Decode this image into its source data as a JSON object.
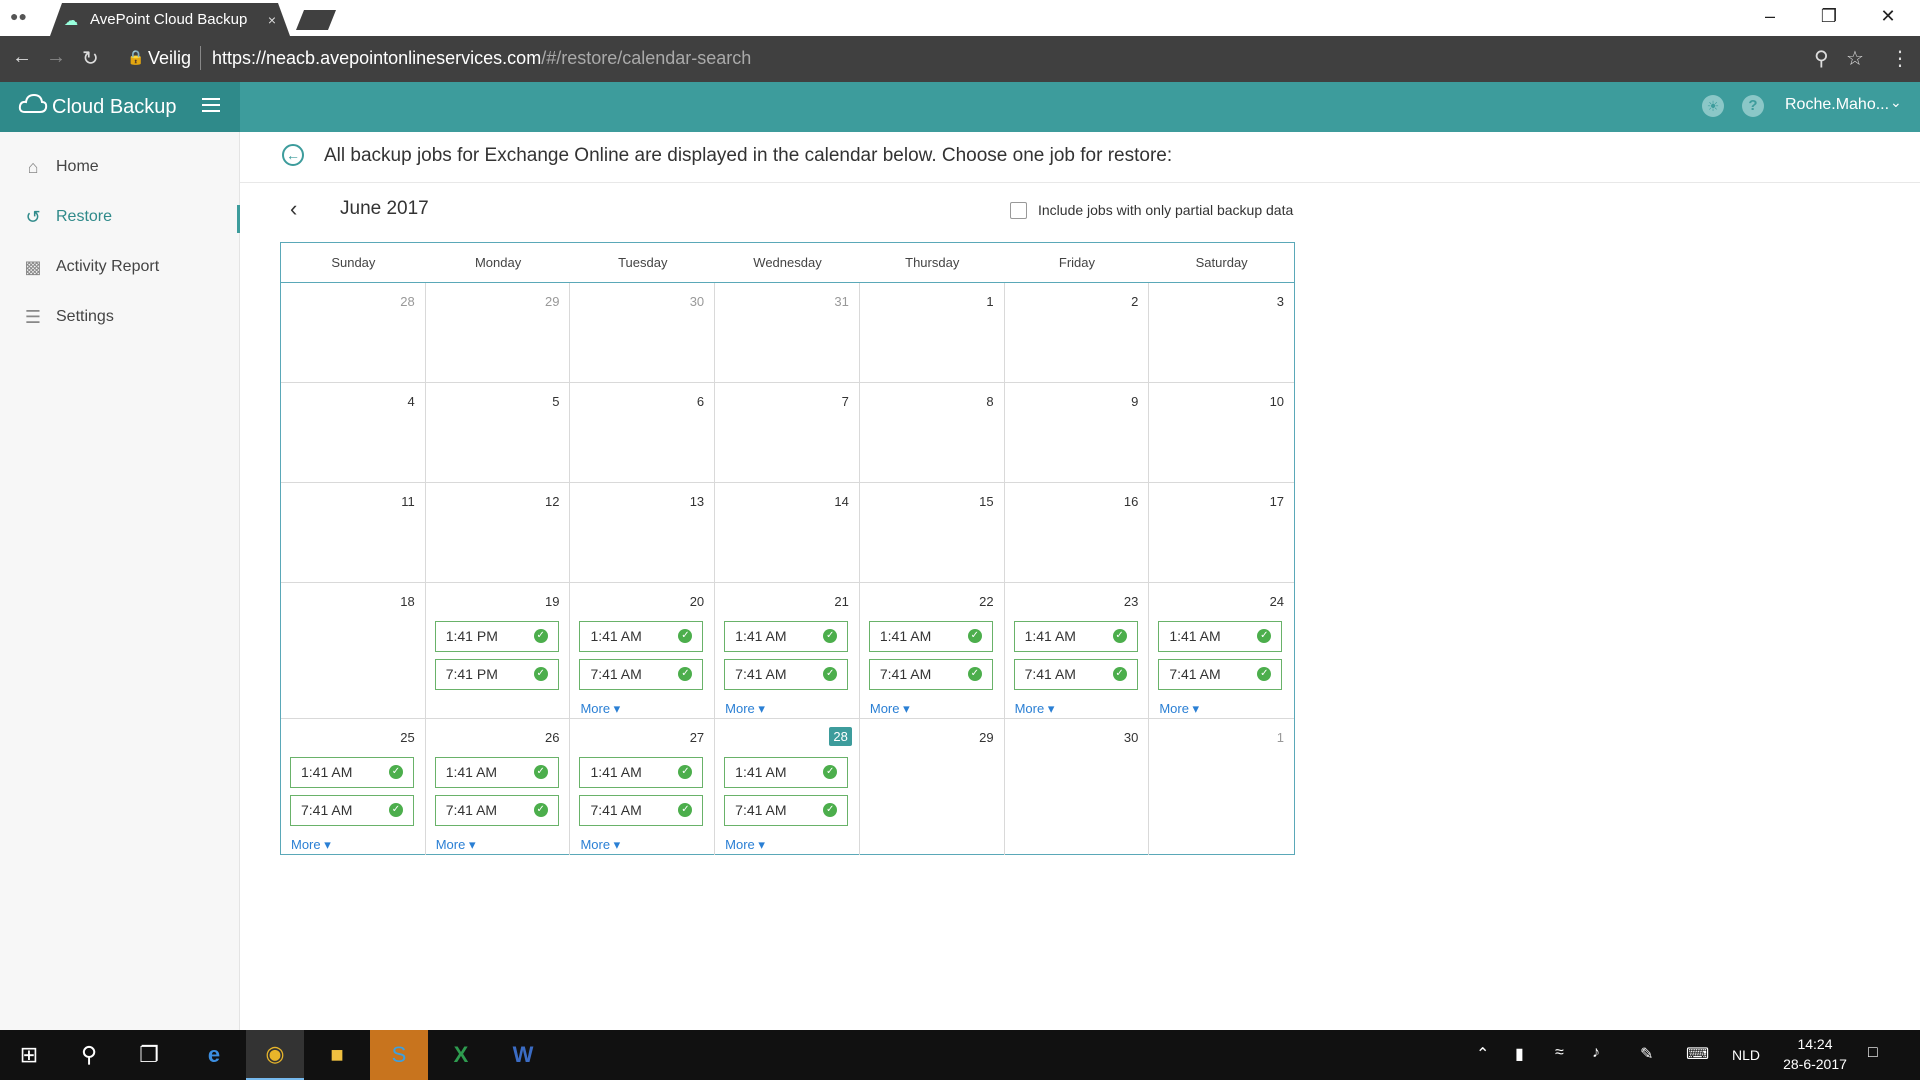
{
  "browser": {
    "tab_title": "AvePoint Cloud Backup",
    "tab_close": "×",
    "secure_label": "Veilig",
    "url_main": "https://neacb.avepointonlineservices.com",
    "url_rest": "/#/restore/calendar-search"
  },
  "app": {
    "brand_name": "Cloud Backup",
    "user_name": "Roche.Maho...",
    "accent_color": "#3d9c9c"
  },
  "sidebar": {
    "items": [
      {
        "label": "Home",
        "icon": "home-icon"
      },
      {
        "label": "Restore",
        "icon": "restore-icon",
        "active": true
      },
      {
        "label": "Activity Report",
        "icon": "chart-icon"
      },
      {
        "label": "Settings",
        "icon": "sliders-icon"
      }
    ]
  },
  "main": {
    "description": "All backup jobs for Exchange Online are displayed in the calendar below. Choose one job for restore:",
    "month": "June 2017",
    "partial_label": "Include jobs with only partial backup data"
  },
  "calendar": {
    "weekdays": [
      "Sunday",
      "Monday",
      "Tuesday",
      "Wednesday",
      "Thursday",
      "Friday",
      "Saturday"
    ],
    "more_label": "More",
    "weeks": [
      [
        {
          "d": "28",
          "other": true
        },
        {
          "d": "29",
          "other": true
        },
        {
          "d": "30",
          "other": true
        },
        {
          "d": "31",
          "other": true
        },
        {
          "d": "1"
        },
        {
          "d": "2"
        },
        {
          "d": "3"
        }
      ],
      [
        {
          "d": "4"
        },
        {
          "d": "5"
        },
        {
          "d": "6"
        },
        {
          "d": "7"
        },
        {
          "d": "8"
        },
        {
          "d": "9"
        },
        {
          "d": "10"
        }
      ],
      [
        {
          "d": "11"
        },
        {
          "d": "12"
        },
        {
          "d": "13"
        },
        {
          "d": "14"
        },
        {
          "d": "15"
        },
        {
          "d": "16"
        },
        {
          "d": "17"
        }
      ],
      [
        {
          "d": "18"
        },
        {
          "d": "19",
          "jobs": [
            "1:41 PM",
            "7:41 PM"
          ]
        },
        {
          "d": "20",
          "jobs": [
            "1:41 AM",
            "7:41 AM"
          ],
          "more": true
        },
        {
          "d": "21",
          "jobs": [
            "1:41 AM",
            "7:41 AM"
          ],
          "more": true
        },
        {
          "d": "22",
          "jobs": [
            "1:41 AM",
            "7:41 AM"
          ],
          "more": true
        },
        {
          "d": "23",
          "jobs": [
            "1:41 AM",
            "7:41 AM"
          ],
          "more": true
        },
        {
          "d": "24",
          "jobs": [
            "1:41 AM",
            "7:41 AM"
          ],
          "more": true
        }
      ],
      [
        {
          "d": "25",
          "jobs": [
            "1:41 AM",
            "7:41 AM"
          ],
          "more": true
        },
        {
          "d": "26",
          "jobs": [
            "1:41 AM",
            "7:41 AM"
          ],
          "more": true
        },
        {
          "d": "27",
          "jobs": [
            "1:41 AM",
            "7:41 AM"
          ],
          "more": true
        },
        {
          "d": "28",
          "today": true,
          "jobs": [
            "1:41 AM",
            "7:41 AM"
          ],
          "more": true
        },
        {
          "d": "29"
        },
        {
          "d": "30"
        },
        {
          "d": "1",
          "other": true
        }
      ]
    ]
  },
  "taskbar": {
    "language": "NLD",
    "time": "14:24",
    "date": "28-6-2017"
  }
}
